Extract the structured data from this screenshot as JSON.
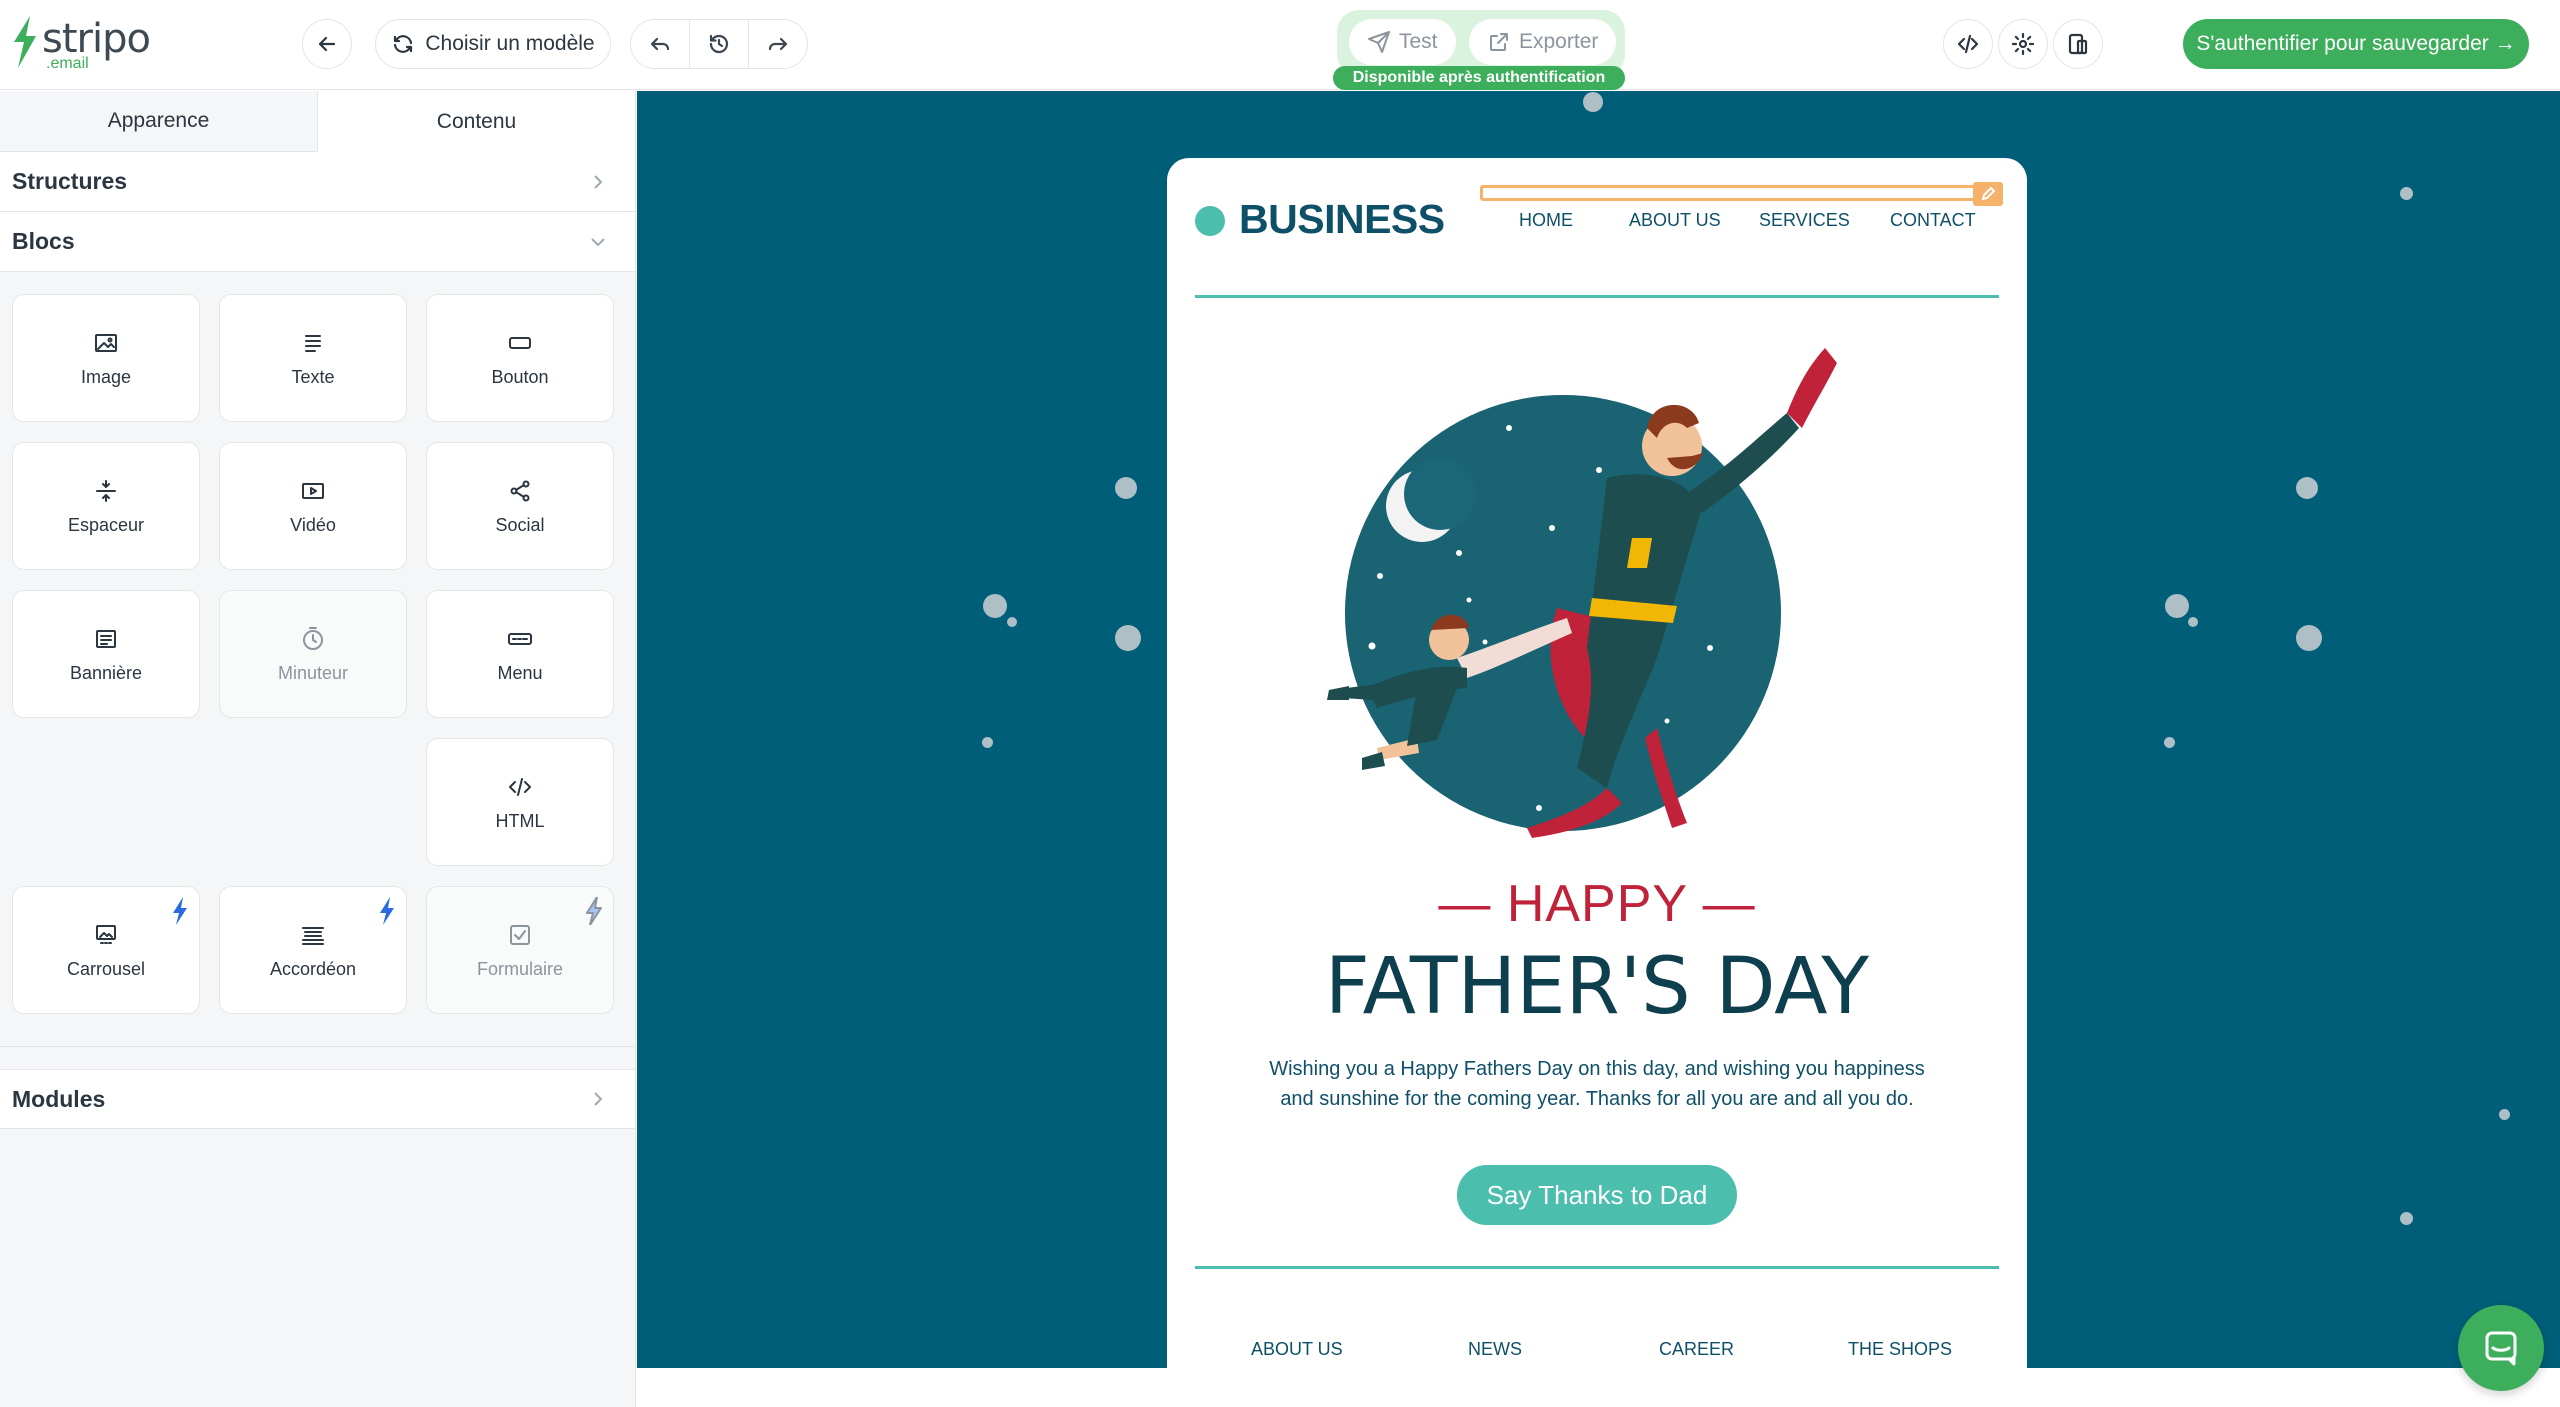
{
  "app": {
    "logo_word": "stripo",
    "logo_sub": ".email"
  },
  "toolbar": {
    "choose_template": "Choisir un modèle",
    "test": "Test",
    "export": "Exporter",
    "available_badge": "Disponible après authentification",
    "auth_button": "S'authentifier pour sauvegarder →"
  },
  "sidebar": {
    "tabs": [
      "Apparence",
      "Contenu"
    ],
    "active_tab": "Contenu",
    "sections": {
      "structures": "Structures",
      "blocks": "Blocs",
      "modules": "Modules"
    },
    "blocks": [
      {
        "label": "Image",
        "icon": "image-icon"
      },
      {
        "label": "Texte",
        "icon": "text-icon"
      },
      {
        "label": "Bouton",
        "icon": "button-icon"
      },
      {
        "label": "Espaceur",
        "icon": "spacer-icon"
      },
      {
        "label": "Vidéo",
        "icon": "video-icon"
      },
      {
        "label": "Social",
        "icon": "share-icon"
      },
      {
        "label": "Bannière",
        "icon": "banner-icon"
      },
      {
        "label": "Minuteur",
        "icon": "timer-icon",
        "disabled": true
      },
      {
        "label": "Menu",
        "icon": "menu-icon"
      },
      {
        "label": "HTML",
        "icon": "code-icon"
      },
      {
        "label": "Carrousel",
        "icon": "carousel-icon",
        "amp": true
      },
      {
        "label": "Accordéon",
        "icon": "accordion-icon",
        "amp": true
      },
      {
        "label": "Formulaire",
        "icon": "form-icon",
        "amp": true,
        "disabled": true
      }
    ]
  },
  "email": {
    "brand": "BUSINESS",
    "nav": [
      "HOME",
      "ABOUT US",
      "SERVICES",
      "CONTACT"
    ],
    "happy": "— HAPPY —",
    "title": "FATHER'S DAY",
    "body": "Wishing you a Happy Fathers Day on this day, and wishing you happiness and sunshine for the coming year. Thanks for all you are and all you do.",
    "cta": "Say Thanks to Dad",
    "footer_nav": [
      "ABOUT US",
      "NEWS",
      "CAREER",
      "THE SHOPS"
    ]
  },
  "colors": {
    "accent_green": "#3dae5c",
    "canvas_bg": "#005e79",
    "teal": "#4bbeae",
    "navy_text": "#0e5068",
    "red": "#c0223a",
    "selection_orange": "#f6b26b"
  }
}
